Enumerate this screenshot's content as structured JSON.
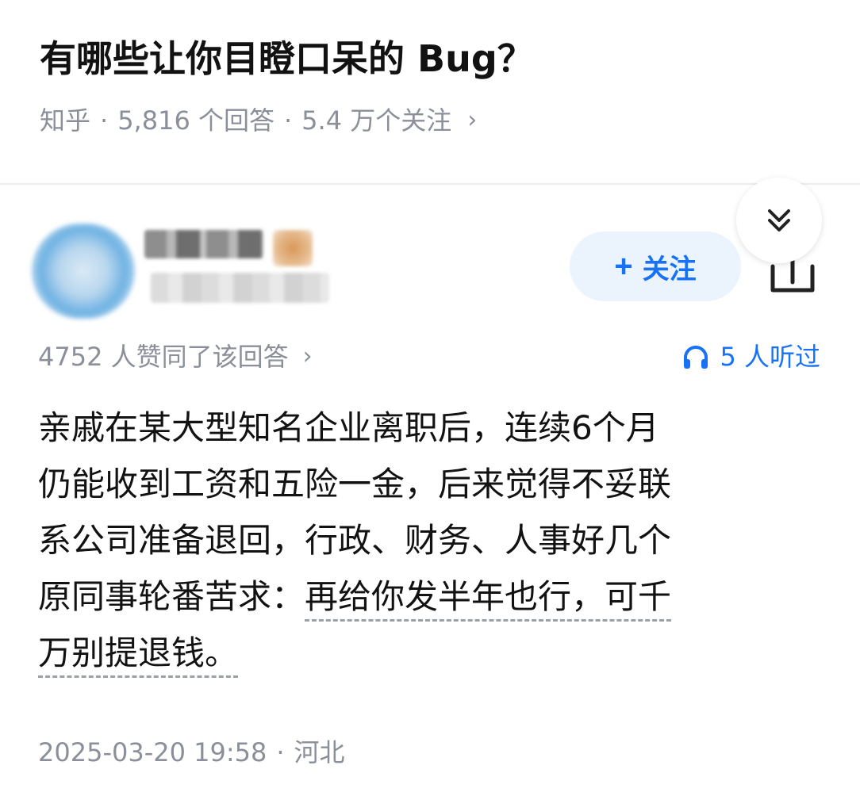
{
  "question": {
    "title": "有哪些让你目瞪口呆的 Bug？",
    "source": "知乎",
    "separator": "·",
    "answers_count": "5,816 个回答",
    "followers_count": "5.4 万个关注",
    "chevron": "›"
  },
  "answer": {
    "follow_label": "关注",
    "follow_plus": "+",
    "upvotes_text": "4752 人赞同了该回答",
    "upvotes_chevron": "›",
    "listened_text": "5 人听过",
    "body_lines": [
      "亲戚在某大型知名企业离职后，连续6个月",
      "仍能收到工资和五险一金，后来觉得不妥联",
      "系公司准备退回，行政、财务、人事好几个",
      "原同事轮番苦求：",
      "再给你发半年也行，可千",
      "万别提退钱。"
    ],
    "timestamp": "2025-03-20 19:58",
    "location": "河北"
  },
  "icons": {
    "collapse": "double-chevron-down-icon",
    "share": "share-icon",
    "headphones": "headphones-icon"
  },
  "colors": {
    "accent": "#1772f6",
    "follow_bg": "#ebf4fd",
    "meta_text": "#8a8f99",
    "body_text": "#121212"
  }
}
